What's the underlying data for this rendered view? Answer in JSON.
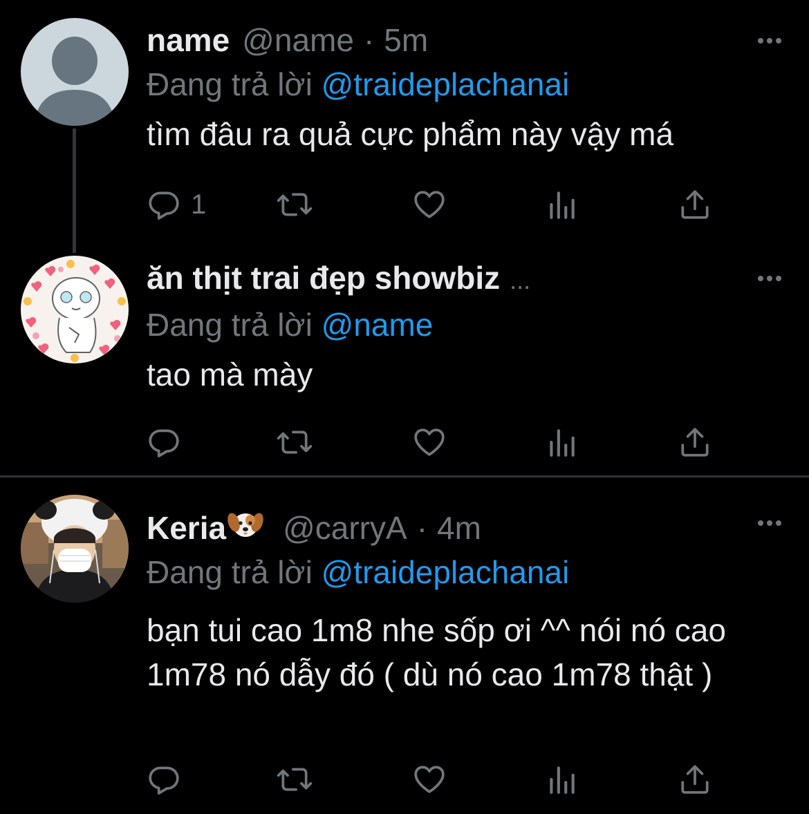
{
  "tweets": [
    {
      "display_name": "name",
      "handle": "@name",
      "separator": "·",
      "time": "5m",
      "reply_prefix": "Đang trả lời",
      "reply_to": "@traideplachanai",
      "text": "tìm đâu ra quả cực phẩm này vậy má",
      "reply_count": "1",
      "avatar": "default-avatar-icon"
    },
    {
      "display_name": "ăn thịt trai đẹp showbiz",
      "truncation": "...",
      "reply_prefix": "Đang trả lời",
      "reply_to": "@name",
      "text": "tao mà mày",
      "reply_count": "",
      "avatar": "cartoon-hearts-avatar"
    },
    {
      "display_name": "Keria",
      "name_emoji": "dog-face-emoji",
      "handle": "@carryA",
      "separator": "·",
      "time": "4m",
      "reply_prefix": "Đang trả lời",
      "reply_to": "@traideplachanai",
      "text": "bạn tui cao 1m8 nhe sốp ơi ^^ nói nó cao 1m78 nó dẫy đó ( dù nó cao 1m78 thật )",
      "reply_count": "",
      "avatar": "photo-avatar"
    }
  ],
  "icons": {
    "reply": "reply-icon",
    "retweet": "retweet-icon",
    "like": "heart-icon",
    "views": "analytics-icon",
    "share": "share-icon",
    "more": "more-icon"
  },
  "colors": {
    "background": "#000000",
    "text": "#e7e9ea",
    "muted": "#71767b",
    "link": "#1d9bf0",
    "divider": "#2f3336"
  }
}
